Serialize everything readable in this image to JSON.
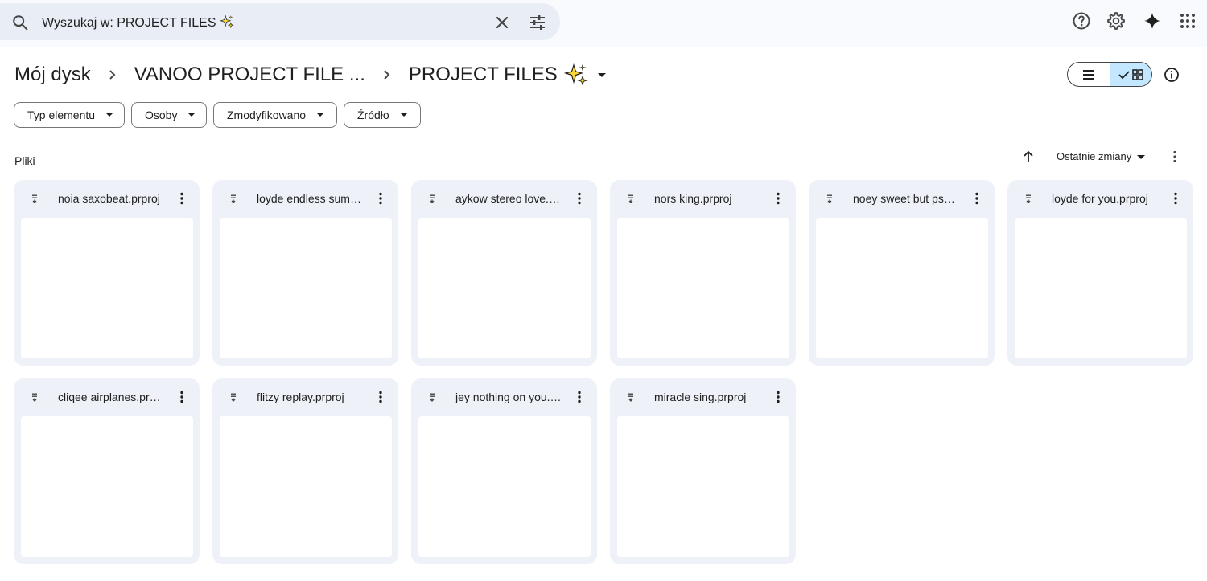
{
  "search": {
    "text": "Wyszukaj w: PROJECT FILES"
  },
  "breadcrumb": {
    "root": "Mój dysk",
    "parent": "VANOO PROJECT FILE ...",
    "current": "PROJECT FILES"
  },
  "filters": [
    {
      "label": "Typ elementu"
    },
    {
      "label": "Osoby"
    },
    {
      "label": "Zmodyfikowano"
    },
    {
      "label": "Źródło"
    }
  ],
  "section": {
    "label": "Pliki"
  },
  "sort": {
    "label": "Ostatnie zmiany"
  },
  "files": [
    {
      "name": "noia saxobeat.prproj"
    },
    {
      "name": "loyde endless summer.prproj"
    },
    {
      "name": "aykow stereo love.prproj"
    },
    {
      "name": "nors king.prproj"
    },
    {
      "name": "noey sweet but psycho.prproj"
    },
    {
      "name": "loyde for you.prproj"
    },
    {
      "name": "cliqee airplanes.prproj"
    },
    {
      "name": "flitzy replay.prproj"
    },
    {
      "name": "jey nothing on you.prproj"
    },
    {
      "name": "miracle sing.prproj"
    }
  ],
  "colors": {
    "accent_selected": "#c2e7ff",
    "search_bg": "#e9eef6",
    "card_bg": "#eef2f8",
    "page_bg": "#f8fafd"
  },
  "icons": {
    "search": "search-icon",
    "clear": "close-icon",
    "tune": "tune-icon",
    "help": "help-icon",
    "settings": "gear-icon",
    "gemini": "sparkle-icon",
    "apps": "apps-grid-icon",
    "file": "file-icon",
    "more": "more-vert-icon"
  }
}
